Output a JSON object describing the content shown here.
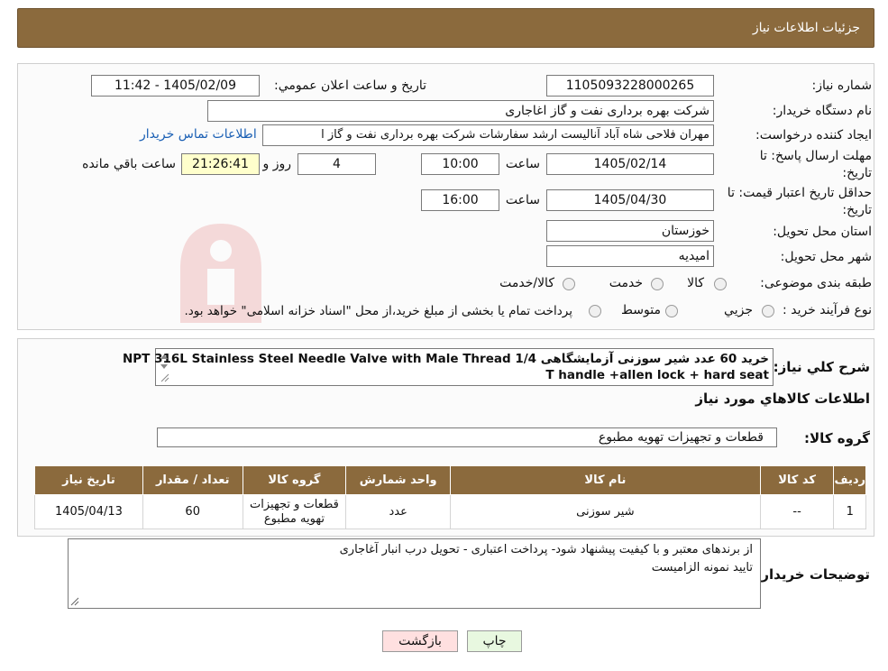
{
  "header": {
    "title": "جزئيات اطلاعات نياز"
  },
  "fields": {
    "need_number_label": "شماره نیاز:",
    "need_number": "1105093228000265",
    "announce_label": "تاريخ و ساعت اعلان عمومي:",
    "announce_value": "1405/02/09 - 11:42",
    "buyer_label": "نام دستگاه خريدار:",
    "buyer_value": "شرکت بهره برداری نفت و گاز اغاجاری",
    "creator_label": "ايجاد کننده درخواست:",
    "creator_value": "مهران فلاحی شاه آباد آنالیست ارشد سفارشات شرکت بهره برداری نفت و گاز ا",
    "contact_link": "اطلاعات تماس خريدار",
    "deadline_label_1": "مهلت ارسال پاسخ: تا",
    "deadline_label_2": "تاريخ:",
    "deadline_date": "1405/02/14",
    "time_label": "ساعت",
    "deadline_time": "10:00",
    "days_value": "4",
    "days_label": "روز و",
    "remaining_time": "21:26:41",
    "remaining_label": "ساعت باقي مانده",
    "validity_label_1": "حداقل تاريخ اعتبار قيمت: تا",
    "validity_label_2": "تاريخ:",
    "validity_date": "1405/04/30",
    "validity_time": "16:00",
    "province_label": "استان محل تحويل:",
    "province_value": "خوزستان",
    "city_label": "شهر محل تحويل:",
    "city_value": "امیدیه",
    "category_label": "طبقه بندی موضوعی:",
    "category_options": [
      "کالا",
      "خدمت",
      "کالا/خدمت"
    ],
    "process_label": "نوع فرآيند خريد :",
    "process_options": [
      "جزيي",
      "متوسط"
    ],
    "process_note": "پرداخت تمام يا بخشی از مبلغ خريد،از محل \"اسناد خزانه اسلامی\" خواهد بود."
  },
  "summary": {
    "label": "شرح كلي نياز:",
    "text_line1": "خرید 60 عدد شیر سوزنی آزمایشگاهی NPT 316L Stainless Steel Needle Valve with Male Thread 1/4",
    "text_line2": "T handle +allen lock + hard seat"
  },
  "goods": {
    "section_title": "اطلاعات كالاهاي مورد نياز",
    "group_label": "گروه كالا:",
    "group_value": "قطعات و تجهیزات تهویه مطبوع"
  },
  "table": {
    "headers": [
      "رديف",
      "كد كالا",
      "نام كالا",
      "واحد شمارش",
      "گروه كالا",
      "تعداد / مقدار",
      "تاريخ نياز"
    ],
    "rows": [
      [
        "1",
        "--",
        "شیر سوزنی",
        "عدد",
        "قطعات و تجهيزات تهويه مطبوع",
        "60",
        "1405/04/13"
      ]
    ]
  },
  "notes": {
    "label": "توضيحات خريدار:",
    "line1": "از برندهای معتبر و با کیفیت پیشنهاد شود- پرداخت اعتباری - تحویل درب انبار آغاجاری",
    "line2": "تایید نمونه الزامیست"
  },
  "buttons": {
    "print": "چاپ",
    "back": "بازگشت"
  },
  "colors": {
    "header": "#8b6a3d",
    "print_btn": "#e8f8e0",
    "back_btn": "#ffe0e0",
    "remaining_bg": "#ffffcc"
  }
}
